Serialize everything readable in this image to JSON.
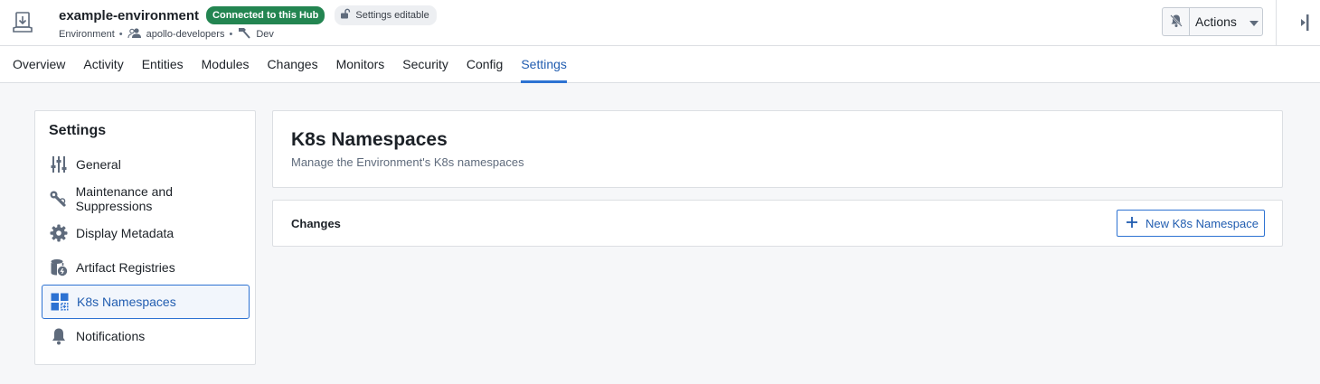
{
  "header": {
    "title": "example-environment",
    "hub_badge": "Connected to this Hub",
    "editable_badge": "Settings editable",
    "meta": {
      "type": "Environment",
      "owner": "apollo-developers",
      "stage": "Dev"
    },
    "actions_label": "Actions"
  },
  "tabs": [
    {
      "label": "Overview"
    },
    {
      "label": "Activity"
    },
    {
      "label": "Entities"
    },
    {
      "label": "Modules"
    },
    {
      "label": "Changes"
    },
    {
      "label": "Monitors"
    },
    {
      "label": "Security"
    },
    {
      "label": "Config"
    },
    {
      "label": "Settings"
    }
  ],
  "active_tab": "Settings",
  "sidebar": {
    "title": "Settings",
    "items": [
      {
        "label": "General",
        "icon": "sliders-icon"
      },
      {
        "label": "Maintenance and Suppressions",
        "icon": "wrench-icon"
      },
      {
        "label": "Display Metadata",
        "icon": "gear-icon"
      },
      {
        "label": "Artifact Registries",
        "icon": "database-icon"
      },
      {
        "label": "K8s Namespaces",
        "icon": "grid-icon"
      },
      {
        "label": "Notifications",
        "icon": "bell-icon"
      }
    ],
    "active_item": "K8s Namespaces"
  },
  "main": {
    "title": "K8s Namespaces",
    "subtitle": "Manage the Environment's K8s namespaces",
    "changes_label": "Changes",
    "new_button_label": "New K8s Namespace"
  },
  "colors": {
    "accent": "#2d72d2",
    "success": "#238551",
    "border": "#dcdfe3",
    "background": "#f6f7f9"
  }
}
